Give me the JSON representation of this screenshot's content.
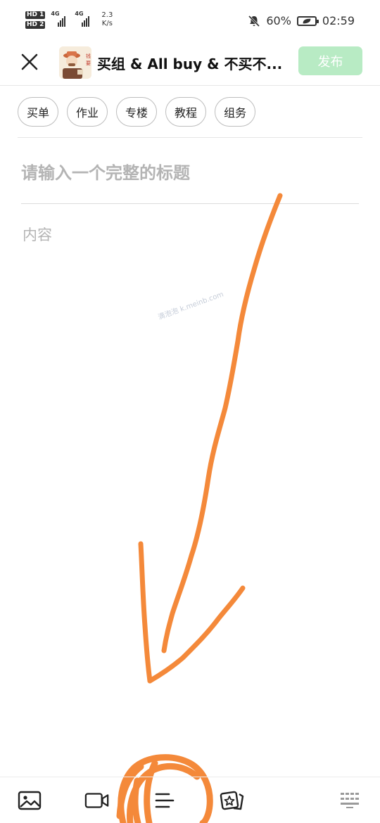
{
  "status_bar": {
    "hd1": "HD 1",
    "hd2": "HD 2",
    "net1": "4G",
    "net2": "4G",
    "speed_value": "2.3",
    "speed_unit": "K/s",
    "battery": "60%",
    "time": "02:59"
  },
  "header": {
    "title": "买组 & All buy & 不买不...",
    "publish_label": "发布",
    "avatar_text": "钱全都要"
  },
  "tags": [
    "买单",
    "作业",
    "专楼",
    "教程",
    "组务"
  ],
  "editor": {
    "title_placeholder": "请输入一个完整的标题",
    "content_placeholder": "内容"
  },
  "watermark": "滴泡泡 k.meinb.com",
  "toolbar": {
    "items": [
      "image-icon",
      "video-icon",
      "format-icon",
      "sticker-icon",
      "keyboard-icon"
    ]
  },
  "colors": {
    "publish_bg": "#b8ebc4",
    "annotation": "#f4893a",
    "placeholder": "#b4b4b4"
  }
}
